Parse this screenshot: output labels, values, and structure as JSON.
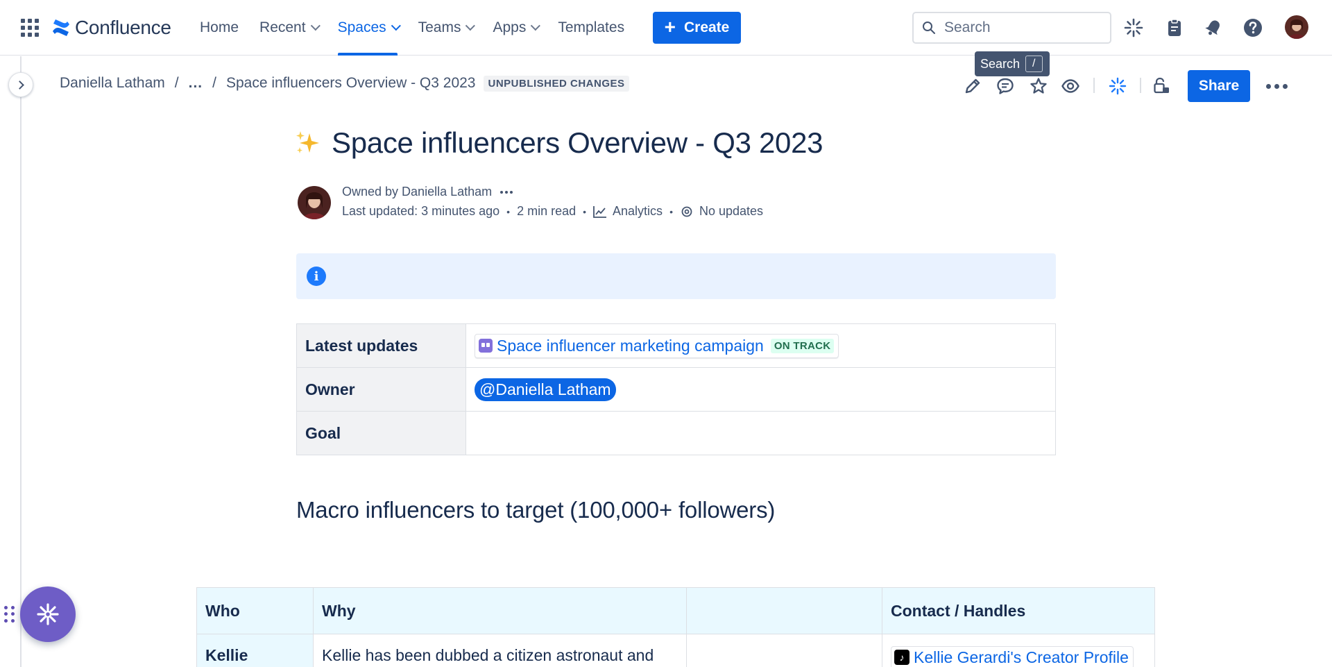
{
  "topnav": {
    "brand": "Confluence",
    "items": [
      {
        "label": "Home",
        "has_dropdown": false,
        "active": false
      },
      {
        "label": "Recent",
        "has_dropdown": true,
        "active": false
      },
      {
        "label": "Spaces",
        "has_dropdown": true,
        "active": true
      },
      {
        "label": "Teams",
        "has_dropdown": true,
        "active": false
      },
      {
        "label": "Apps",
        "has_dropdown": true,
        "active": false
      },
      {
        "label": "Templates",
        "has_dropdown": false,
        "active": false
      }
    ],
    "create_label": "Create",
    "search_placeholder": "Search",
    "search_tooltip": "Search",
    "search_shortcut": "/",
    "accent_color": "#0c66e4"
  },
  "breadcrumb": {
    "items": [
      "Daniella Latham",
      "...",
      "Space influencers Overview - Q3 2023"
    ],
    "status_badge": "UNPUBLISHED CHANGES"
  },
  "page_actions": {
    "share_label": "Share"
  },
  "page": {
    "title": "Space influencers Overview - Q3 2023",
    "title_emoji": "sparkles",
    "owned_by": "Owned by Daniella Latham",
    "last_updated": "Last updated: 3 minutes ago",
    "read_time": "2 min read",
    "analytics_label": "Analytics",
    "updates_label": "No updates"
  },
  "meta_table": {
    "rows": [
      {
        "label": "Latest updates",
        "link_text": "Space influencer marketing campaign",
        "status": "ON TRACK"
      },
      {
        "label": "Owner",
        "mention": "@Daniella Latham"
      },
      {
        "label": "Goal",
        "value": ""
      }
    ]
  },
  "section_heading": "Macro influencers to target (100,000+ followers)",
  "influencer_table": {
    "headers": [
      "Who",
      "Why",
      "",
      "Contact / Handles"
    ],
    "rows": [
      {
        "who": "Kellie",
        "why": "Kellie has been dubbed a citizen astronaut and",
        "blank": "",
        "contact": "Kellie Gerardi's Creator Profile"
      }
    ]
  }
}
